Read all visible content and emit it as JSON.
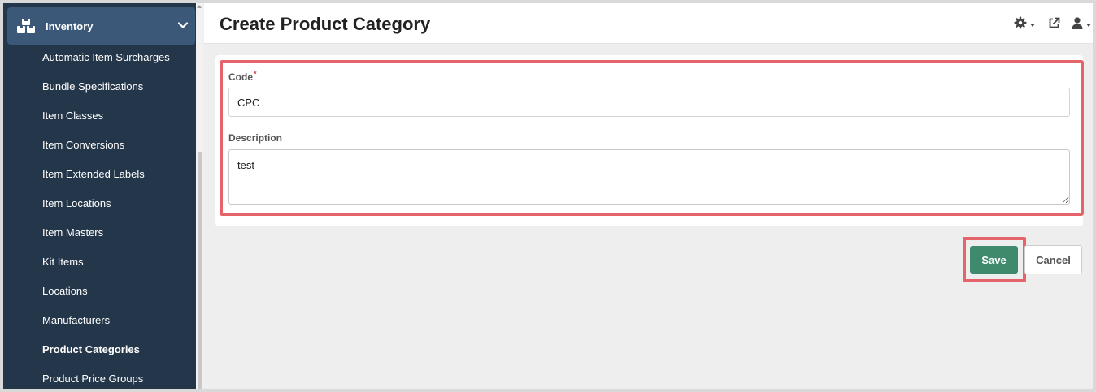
{
  "sidebar": {
    "section_label": "Inventory",
    "section_icon": "boxes-icon",
    "items": [
      {
        "label": "Automatic Item Surcharges",
        "active": false
      },
      {
        "label": "Bundle Specifications",
        "active": false
      },
      {
        "label": "Item Classes",
        "active": false
      },
      {
        "label": "Item Conversions",
        "active": false
      },
      {
        "label": "Item Extended Labels",
        "active": false
      },
      {
        "label": "Item Locations",
        "active": false
      },
      {
        "label": "Item Masters",
        "active": false
      },
      {
        "label": "Kit Items",
        "active": false
      },
      {
        "label": "Locations",
        "active": false
      },
      {
        "label": "Manufacturers",
        "active": false
      },
      {
        "label": "Product Categories",
        "active": true
      },
      {
        "label": "Product Price Groups",
        "active": false
      }
    ]
  },
  "header": {
    "title": "Create Product Category",
    "icons": [
      "settings-gear-icon",
      "external-link-icon",
      "user-icon"
    ]
  },
  "form": {
    "code_label": "Code",
    "code_required_mark": "*",
    "code_value": "CPC",
    "description_label": "Description",
    "description_value": "test"
  },
  "actions": {
    "save_label": "Save",
    "cancel_label": "Cancel"
  },
  "colors": {
    "sidebar_bg": "#24364a",
    "sidebar_header_bg": "#3c5878",
    "save_button": "#3f8a6d",
    "highlight": "#e5636b"
  }
}
